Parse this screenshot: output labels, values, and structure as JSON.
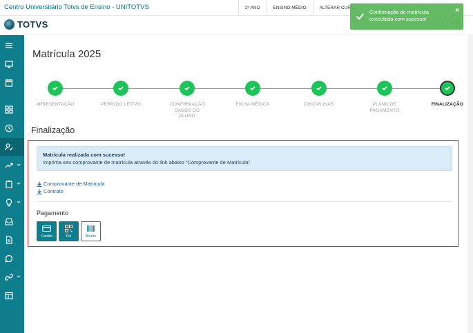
{
  "header": {
    "institution": "Centro Universitário Totvs de Ensino - UNITOTVS",
    "nav": [
      "2º ANO",
      "ENSINO MÉDIO",
      "ALTERAR CURSO"
    ]
  },
  "brand": {
    "logo_text": "TOTVS"
  },
  "sidebar": {
    "items": [
      {
        "icon": "menu-icon"
      },
      {
        "icon": "monitor-icon"
      },
      {
        "icon": "calendar-icon"
      },
      {
        "icon": "grid-icon"
      },
      {
        "icon": "clock-icon"
      },
      {
        "icon": "user-check-icon",
        "active": true
      },
      {
        "icon": "trending-icon",
        "chevron": true
      },
      {
        "icon": "clipboard-icon",
        "chevron": true
      },
      {
        "icon": "lightbulb-icon",
        "chevron": true
      },
      {
        "icon": "inbox-icon"
      },
      {
        "icon": "document-icon"
      },
      {
        "icon": "chat-icon"
      },
      {
        "icon": "link-icon",
        "chevron": true
      },
      {
        "icon": "table-icon"
      }
    ]
  },
  "page": {
    "title": "Matrícula 2025",
    "section_title": "Finalização"
  },
  "stepper": {
    "steps": [
      {
        "label": "APRESENTAÇÃO"
      },
      {
        "label": "PERÍODO LETIVO"
      },
      {
        "label": "CONFIRMAÇÃO DADOS DO ALUNO"
      },
      {
        "label": "FICHA MÉDICA"
      },
      {
        "label": "DISCIPLINAS"
      },
      {
        "label": "PLANO DE PAGAMENTO"
      },
      {
        "label": "FINALIZAÇÃO",
        "current": true
      }
    ]
  },
  "alert": {
    "title": "Matrícula realizada com sucesso!",
    "text": "Imprima seu comprovante de matrícula através do link abaixo \"Comprovante de Matrícula\""
  },
  "links": {
    "comprovante": "Comprovante de Matrícula",
    "contrato": "Contrato"
  },
  "payment": {
    "title": "Pagamento",
    "options": [
      {
        "label": "Cartão",
        "icon": "card-icon",
        "style": "filled"
      },
      {
        "label": "Pix",
        "icon": "qr-icon",
        "style": "filled"
      },
      {
        "label": "Boleto",
        "icon": "barcode-icon",
        "style": "outline"
      }
    ]
  },
  "toast": {
    "message": "Confirmação de matrícula executada com sucesso!",
    "close": "×",
    "color": "#5cb85c"
  },
  "colors": {
    "primary": "#0e7e8c",
    "success": "#1ec45a",
    "highlight": "#d32f2f"
  }
}
